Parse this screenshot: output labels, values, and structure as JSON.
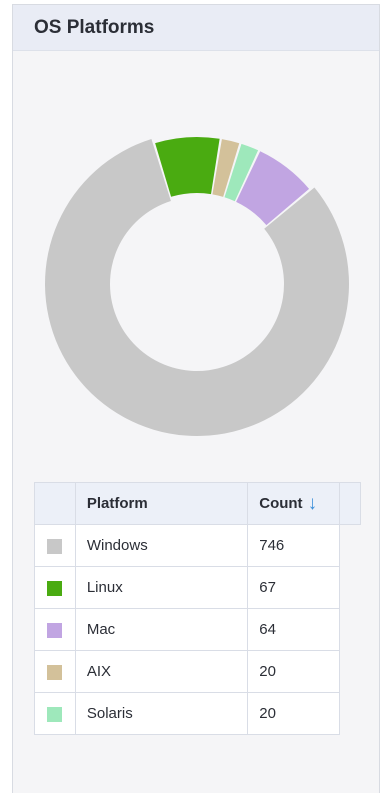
{
  "panel": {
    "title": "OS Platforms"
  },
  "chart_data": {
    "type": "pie",
    "variant": "donut",
    "categories": [
      "Windows",
      "Linux",
      "Mac",
      "AIX",
      "Solaris"
    ],
    "values": [
      746,
      67,
      64,
      20,
      20
    ],
    "colors": [
      "#c8c8c8",
      "#4aab11",
      "#c1a5e2",
      "#d3c19a",
      "#9ee8bb"
    ],
    "slice_order": [
      "Linux",
      "AIX",
      "Solaris",
      "Mac",
      "Windows"
    ],
    "highlighted": "Windows",
    "legend": "table-below"
  },
  "table": {
    "headers": {
      "platform": "Platform",
      "count": "Count"
    },
    "sort_icon": "arrow-down-icon",
    "rows": [
      {
        "platform": "Windows",
        "count": "746",
        "color": "#c8c8c8"
      },
      {
        "platform": "Linux",
        "count": "67",
        "color": "#4aab11"
      },
      {
        "platform": "Mac",
        "count": "64",
        "color": "#c1a5e2"
      },
      {
        "platform": "AIX",
        "count": "20",
        "color": "#d3c19a"
      },
      {
        "platform": "Solaris",
        "count": "20",
        "color": "#9ee8bb"
      }
    ]
  }
}
